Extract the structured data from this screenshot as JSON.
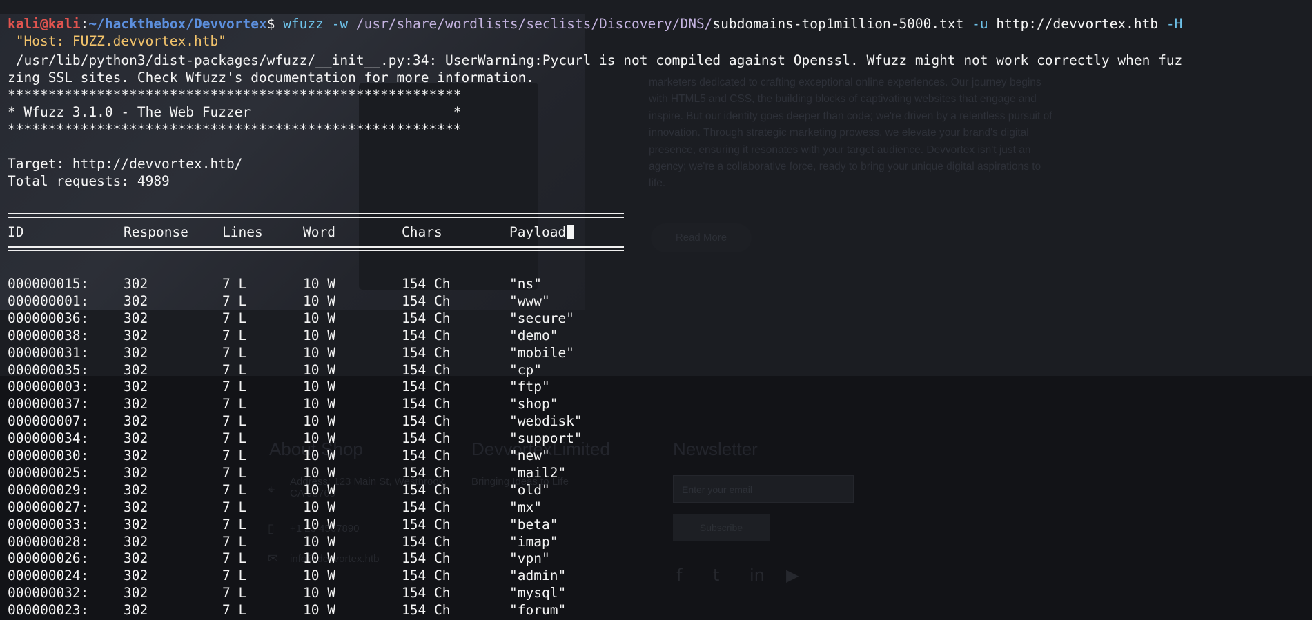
{
  "background": {
    "paragraph": "marketers dedicated to crafting exceptional online experiences. Our journey begins with HTML5 and CSS, the building blocks of captivating websites that engage and inspire. But our identity goes deeper than code; we're driven by a relentless pursuit of innovation. Through strategic marketing prowess, we elevate your brand's digital presence, ensuring it resonates with your target audience. Devvortex isn't just an agency; we're a collaborative force, ready to bring your unique digital aspirations to life.",
    "read_more": "Read More",
    "footer_about": "About Shop",
    "footer_company": "DevvortexLimited",
    "footer_tagline": "Bringing Ideas to Life",
    "footer_address": "Address: 123 Main St, Westbrook, CA 98765",
    "footer_phone": "+1 23 4567890",
    "footer_email": "info@devvortex.htb",
    "newsletter": "Newsletter",
    "email_placeholder": "Enter your email",
    "subscribe": "Subscribe",
    "social_icons": [
      "facebook-icon",
      "twitter-icon",
      "linkedin-icon",
      "youtube-icon"
    ]
  },
  "prompt": {
    "user": "kali@kali",
    "sep": ":",
    "cwd": "~/hackthebox/Devvortex",
    "symbol": "$ ",
    "command": "wfuzz",
    "flag_w": " -w ",
    "wordlist_dir": "/usr/share/wordlists/seclists/Discovery/DNS/",
    "wordlist_file": "subdomains-top1million-5000.txt",
    "flag_u": " -u ",
    "url": "http://devvortex.htb",
    "flag_H": " -H",
    "header_value": " \"Host: FUZZ.devvortex.htb\""
  },
  "warning": [
    " /usr/lib/python3/dist-packages/wfuzz/__init__.py:34: UserWarning:Pycurl is not compiled against Openssl. Wfuzz might not work correctly when fuz",
    "zing SSL sites. Check Wfuzz's documentation for more information."
  ],
  "banner": [
    "********************************************************",
    "* Wfuzz 3.1.0 - The Web Fuzzer                         *",
    "********************************************************"
  ],
  "target_line": "Target: http://devvortex.htb/",
  "total_line": "Total requests: 4989",
  "table": {
    "columns": [
      "ID",
      "Response",
      "Lines",
      "Word",
      "Chars",
      "Payload"
    ],
    "rows": [
      [
        "000000015:",
        "302",
        "7 L",
        "10 W",
        "154 Ch",
        "\"ns\""
      ],
      [
        "000000001:",
        "302",
        "7 L",
        "10 W",
        "154 Ch",
        "\"www\""
      ],
      [
        "000000036:",
        "302",
        "7 L",
        "10 W",
        "154 Ch",
        "\"secure\""
      ],
      [
        "000000038:",
        "302",
        "7 L",
        "10 W",
        "154 Ch",
        "\"demo\""
      ],
      [
        "000000031:",
        "302",
        "7 L",
        "10 W",
        "154 Ch",
        "\"mobile\""
      ],
      [
        "000000035:",
        "302",
        "7 L",
        "10 W",
        "154 Ch",
        "\"cp\""
      ],
      [
        "000000003:",
        "302",
        "7 L",
        "10 W",
        "154 Ch",
        "\"ftp\""
      ],
      [
        "000000037:",
        "302",
        "7 L",
        "10 W",
        "154 Ch",
        "\"shop\""
      ],
      [
        "000000007:",
        "302",
        "7 L",
        "10 W",
        "154 Ch",
        "\"webdisk\""
      ],
      [
        "000000034:",
        "302",
        "7 L",
        "10 W",
        "154 Ch",
        "\"support\""
      ],
      [
        "000000030:",
        "302",
        "7 L",
        "10 W",
        "154 Ch",
        "\"new\""
      ],
      [
        "000000025:",
        "302",
        "7 L",
        "10 W",
        "154 Ch",
        "\"mail2\""
      ],
      [
        "000000029:",
        "302",
        "7 L",
        "10 W",
        "154 Ch",
        "\"old\""
      ],
      [
        "000000027:",
        "302",
        "7 L",
        "10 W",
        "154 Ch",
        "\"mx\""
      ],
      [
        "000000033:",
        "302",
        "7 L",
        "10 W",
        "154 Ch",
        "\"beta\""
      ],
      [
        "000000028:",
        "302",
        "7 L",
        "10 W",
        "154 Ch",
        "\"imap\""
      ],
      [
        "000000026:",
        "302",
        "7 L",
        "10 W",
        "154 Ch",
        "\"vpn\""
      ],
      [
        "000000024:",
        "302",
        "7 L",
        "10 W",
        "154 Ch",
        "\"admin\""
      ],
      [
        "000000032:",
        "302",
        "7 L",
        "10 W",
        "154 Ch",
        "\"mysql\""
      ],
      [
        "000000023:",
        "302",
        "7 L",
        "10 W",
        "154 Ch",
        "\"forum\""
      ]
    ]
  },
  "colors": {
    "background": "#131418",
    "text": "#f4f4f4",
    "prompt_user": "#e0544f",
    "prompt_cwd": "#5c8fdd",
    "command": "#6ec1e8",
    "wordlist_path": "#c4b3e0",
    "quoted_string": "#f2c36b"
  }
}
